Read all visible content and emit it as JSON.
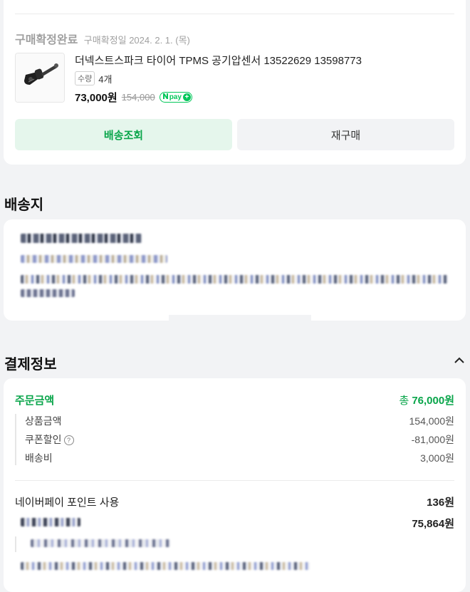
{
  "order": {
    "status": "구매확정완료",
    "confirm_date": "구매확정일 2024. 2. 1. (목)",
    "product_name": "더넥스트스파크 타이어 TPMS 공기압센서 13522629 13598773",
    "qty_label": "수량",
    "qty_value": "4개",
    "price": "73,000원",
    "original_price": "154,000",
    "npay_logo_text": "pay",
    "buttons": {
      "track": "배송조회",
      "rebuy": "재구매"
    }
  },
  "shipping": {
    "title": "배송지"
  },
  "payment": {
    "title": "결제정보",
    "order_amount_label": "주문금액",
    "order_total_prefix": "총",
    "order_total": "76,000원",
    "items": [
      {
        "label": "상품금액",
        "value": "154,000원"
      },
      {
        "label": "쿠폰할인",
        "value": "-81,000원"
      },
      {
        "label": "배송비",
        "value": "3,000원"
      }
    ],
    "point_label": "네이버페이 포인트 사용",
    "point_value": "136원",
    "final_value": "75,864원"
  },
  "colors": {
    "accent_green": "#09a54a",
    "npay_green": "#03c75a",
    "track_bg": "#e5f6ec",
    "page_bg": "#f2f3f5"
  },
  "icons": {
    "chevron": "chevron-up-icon",
    "help": "question-circle-icon",
    "product": "tpms-sensor-image"
  }
}
